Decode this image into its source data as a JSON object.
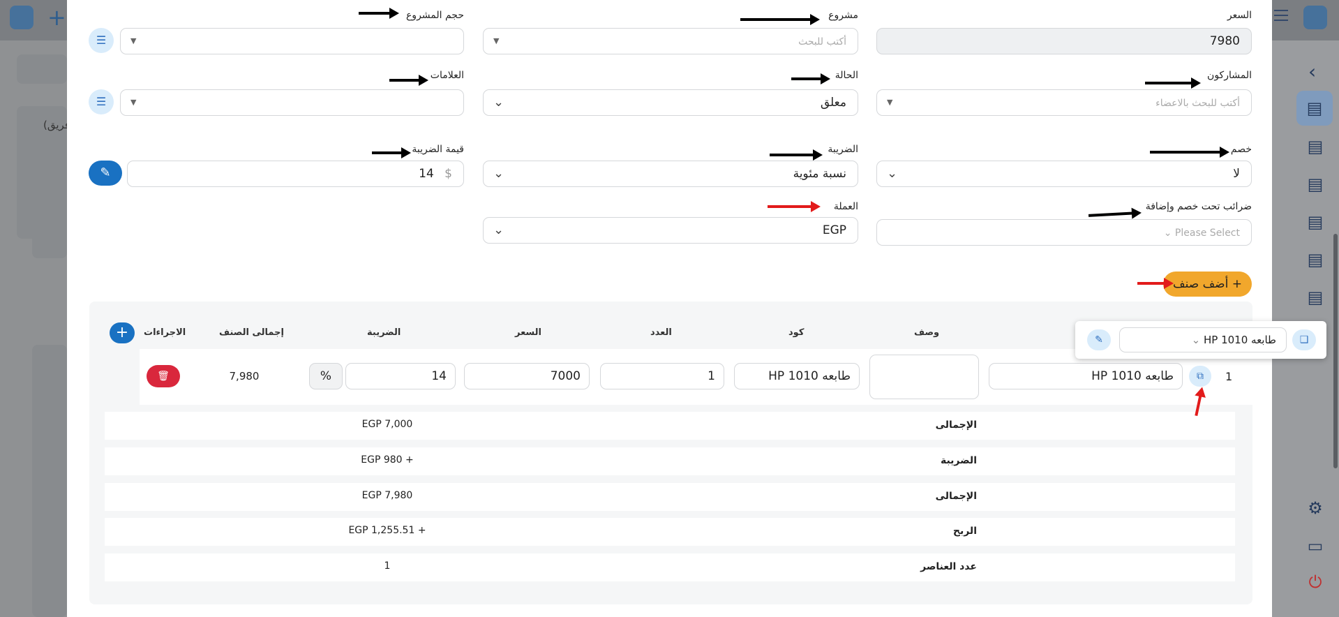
{
  "form": {
    "price": {
      "label": "السعر",
      "value": "7980"
    },
    "project": {
      "label": "مشروع",
      "placeholder": "أكتب للبحث"
    },
    "project_size": {
      "label": "حجم المشروع"
    },
    "participants": {
      "label": "المشاركون",
      "placeholder": "أكتب للبحث بالاعضاء"
    },
    "status": {
      "label": "الحالة",
      "value": "معلق"
    },
    "tags": {
      "label": "العلامات"
    },
    "discount": {
      "label": "خصم",
      "value": "لا"
    },
    "tax": {
      "label": "الضريبة",
      "value": "نسبة مئوية"
    },
    "tax_value": {
      "label": "قيمة الضريبة",
      "value": "14",
      "unit": "$"
    },
    "taxes_under_discount": {
      "label": "ضرائب تحت خصم وإضافة",
      "placeholder": "Please Select"
    },
    "currency": {
      "label": "العملة",
      "value": "EGP"
    },
    "add_item_label": "أضف صنف",
    "add_item_icon": "+"
  },
  "items_table": {
    "headers": {
      "description": "وصف",
      "code": "كود",
      "quantity": "العدد",
      "price": "السعر",
      "tax": "الضريبة",
      "item_total": "إجمالى الصنف",
      "actions": "الاجراءات"
    },
    "row": {
      "index": "1",
      "name": "طابعه HP 1010",
      "code": "طابعه HP 1010",
      "quantity": "1",
      "price": "7000",
      "tax": "14",
      "tax_unit": "%",
      "item_total": "7,980"
    },
    "popup_select_value": "طابعه HP 1010"
  },
  "summary": [
    {
      "label": "الإجمالى",
      "value": "EGP 7,000"
    },
    {
      "label": "الضريبة",
      "value": "+ EGP 980"
    },
    {
      "label": "الإجمالى",
      "value": "EGP 7,980"
    },
    {
      "label": "الربح",
      "value": "+ EGP 1,255.51"
    },
    {
      "label": "عدد العناصر",
      "value": "1"
    }
  ],
  "background": {
    "partial_text": "فريق)"
  },
  "colors": {
    "accent_orange": "#f1a72c",
    "primary_blue": "#1971c2",
    "danger_red": "#d9273c",
    "annotation_red": "#e21b1b"
  }
}
